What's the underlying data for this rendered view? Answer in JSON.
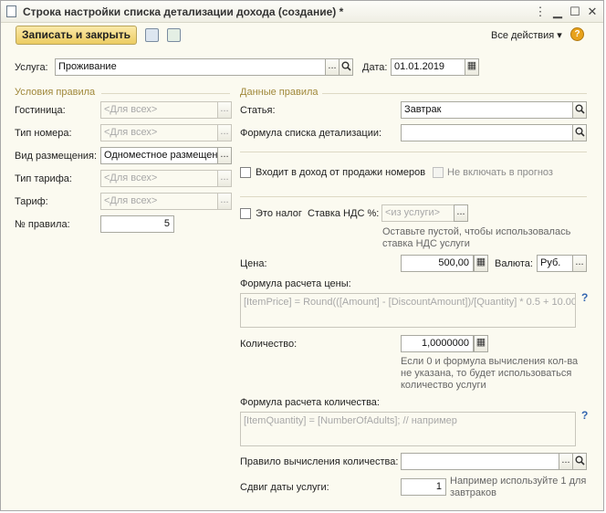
{
  "window": {
    "title": "Строка настройки списка детализации дохода (создание) *"
  },
  "toolbar": {
    "save_close": "Записать и закрыть",
    "all_actions": "Все действия ▾",
    "help": "?"
  },
  "header": {
    "service_label": "Услуга:",
    "service_value": "Проживание",
    "date_label": "Дата:",
    "date_value": "01.01.2019"
  },
  "conditions": {
    "title": "Условия правила",
    "hotel_label": "Гостиница:",
    "hotel_value": "<Для всех>",
    "room_type_label": "Тип номера:",
    "room_type_value": "<Для всех>",
    "accommodation_label": "Вид размещения:",
    "accommodation_value": "Одноместное размещен",
    "rate_type_label": "Тип тарифа:",
    "rate_type_value": "<Для всех>",
    "rate_label": "Тариф:",
    "rate_value": "<Для всех>",
    "rule_no_label": "№ правила:",
    "rule_no_value": "5"
  },
  "rule_data": {
    "title": "Данные правила",
    "article_label": "Статья:",
    "article_value": "Завтрак",
    "formula_list_label": "Формула списка детализации:",
    "formula_list_value": "",
    "income_rooms_label": "Входит в доход от продажи номеров",
    "no_forecast_label": "Не включать в прогноз",
    "tax_label": "Это налог",
    "vat_label": "Ставка НДС %:",
    "vat_placeholder": "<из услуги>",
    "vat_hint": "Оставьте пустой, чтобы использовалась ставка НДС услуги",
    "price_label": "Цена:",
    "price_value": "500,00",
    "currency_label": "Валюта:",
    "currency_value": "Руб.",
    "price_formula_label": "Формула расчета цены:",
    "price_formula_placeholder": "[ItemPrice] = Round(([Amount] - [DiscountAmount])/[Quantity] * 0.5 + 10.00...",
    "quantity_label": "Количество:",
    "quantity_value": "1,0000000",
    "quantity_hint": "Если 0 и формула вычисления кол-ва не указана, то будет использоваться количество услуги",
    "quantity_formula_label": "Формула расчета количества:",
    "quantity_formula_placeholder": "[ItemQuantity] = [NumberOfAdults]; // например",
    "quantity_rule_label": "Правило вычисления количества:",
    "quantity_rule_value": "",
    "date_shift_label": "Сдвиг даты услуги:",
    "date_shift_value": "1",
    "date_shift_hint": "Например используйте 1 для завтраков"
  }
}
